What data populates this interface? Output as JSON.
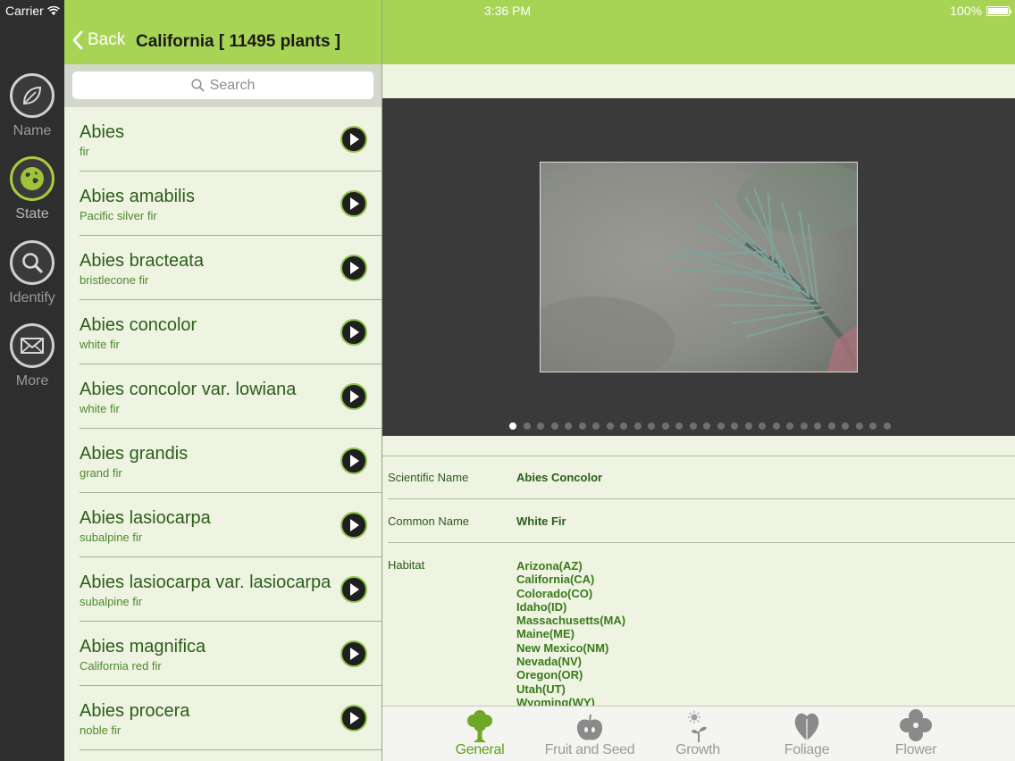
{
  "status_bar": {
    "carrier": "Carrier",
    "time": "3:36 PM",
    "battery": "100%"
  },
  "rail": [
    {
      "label": "Name",
      "icon": "leaf-icon"
    },
    {
      "label": "State",
      "icon": "globe-icon"
    },
    {
      "label": "Identify",
      "icon": "magnifier-icon"
    },
    {
      "label": "More",
      "icon": "envelope-icon"
    }
  ],
  "master": {
    "back_label": "Back",
    "title": "California [ 11495 plants ]",
    "search_placeholder": "Search",
    "items": [
      {
        "name": "Abies",
        "common": "fir"
      },
      {
        "name": "Abies amabilis",
        "common": "Pacific silver fir"
      },
      {
        "name": "Abies bracteata",
        "common": "bristlecone fir"
      },
      {
        "name": "Abies concolor",
        "common": "white fir"
      },
      {
        "name": "Abies concolor var. lowiana",
        "common": "white fir"
      },
      {
        "name": "Abies grandis",
        "common": "grand fir"
      },
      {
        "name": "Abies lasiocarpa",
        "common": "subalpine fir"
      },
      {
        "name": "Abies lasiocarpa var. lasiocarpa",
        "common": "subalpine fir"
      },
      {
        "name": "Abies magnifica",
        "common": "California red fir"
      },
      {
        "name": "Abies procera",
        "common": "noble fir"
      }
    ]
  },
  "detail": {
    "gallery": {
      "total_pages": 28,
      "current_page": 1
    },
    "scientific_label": "Scientific Name",
    "scientific_value": "Abies Concolor",
    "common_label": "Common Name",
    "common_value": "White Fir",
    "habitat_label": "Habitat",
    "habitat": [
      "Arizona(AZ)",
      "California(CA)",
      "Colorado(CO)",
      "Idaho(ID)",
      "Massachusetts(MA)",
      "Maine(ME)",
      "New Mexico(NM)",
      "Nevada(NV)",
      "Oregon(OR)",
      "Utah(UT)",
      "Wyoming(WY)"
    ]
  },
  "tabs": [
    {
      "label": "General",
      "icon": "tree-icon",
      "active": true
    },
    {
      "label": "Fruit and Seed",
      "icon": "apple-icon",
      "active": false
    },
    {
      "label": "Growth",
      "icon": "sprout-icon",
      "active": false
    },
    {
      "label": "Foliage",
      "icon": "leaf-icon",
      "active": false
    },
    {
      "label": "Flower",
      "icon": "flower-icon",
      "active": false
    }
  ],
  "colors": {
    "accent_green": "#a8d456",
    "text_green": "#2b5e18",
    "rail_bg": "#2e2e2e"
  }
}
